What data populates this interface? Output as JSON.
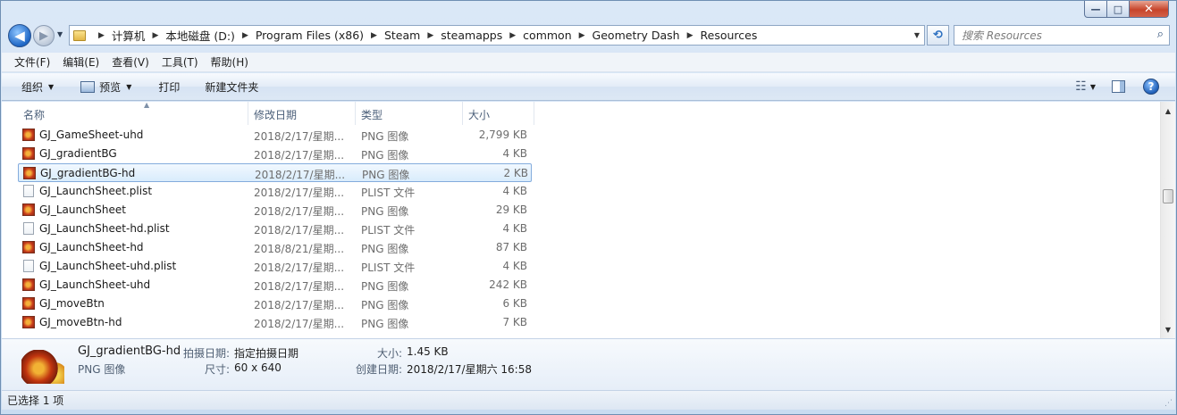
{
  "window": {
    "minimize": "—",
    "maximize": "□",
    "close": "✕"
  },
  "nav": {
    "back": "◀",
    "forward": "▶",
    "recent": "▼",
    "breadcrumb": [
      "计算机",
      "本地磁盘 (D:)",
      "Program Files (x86)",
      "Steam",
      "steamapps",
      "common",
      "Geometry Dash",
      "Resources"
    ],
    "dropdown": "▼",
    "refresh": "⟲",
    "search_placeholder": "搜索 Resources",
    "search_icon": "⌕"
  },
  "menu": [
    "文件(F)",
    "编辑(E)",
    "查看(V)",
    "工具(T)",
    "帮助(H)"
  ],
  "commands": {
    "organize": "组织",
    "preview": "预览",
    "print": "打印",
    "new_folder": "新建文件夹",
    "help": "?"
  },
  "columns": {
    "name": "名称",
    "date": "修改日期",
    "type": "类型",
    "size": "大小"
  },
  "files": [
    {
      "name": "GJ_GameSheet-uhd",
      "date": "2018/2/17/星期...",
      "type": "PNG 图像",
      "size": "2,799 KB",
      "icon": "png-icon"
    },
    {
      "name": "GJ_gradientBG",
      "date": "2018/2/17/星期...",
      "type": "PNG 图像",
      "size": "4 KB",
      "icon": "png-icon"
    },
    {
      "name": "GJ_gradientBG-hd",
      "date": "2018/2/17/星期...",
      "type": "PNG 图像",
      "size": "2 KB",
      "icon": "png-icon",
      "selected": true
    },
    {
      "name": "GJ_LaunchSheet.plist",
      "date": "2018/2/17/星期...",
      "type": "PLIST 文件",
      "size": "4 KB",
      "icon": "file-icon"
    },
    {
      "name": "GJ_LaunchSheet",
      "date": "2018/2/17/星期...",
      "type": "PNG 图像",
      "size": "29 KB",
      "icon": "png-icon"
    },
    {
      "name": "GJ_LaunchSheet-hd.plist",
      "date": "2018/2/17/星期...",
      "type": "PLIST 文件",
      "size": "4 KB",
      "icon": "file-icon"
    },
    {
      "name": "GJ_LaunchSheet-hd",
      "date": "2018/8/21/星期...",
      "type": "PNG 图像",
      "size": "87 KB",
      "icon": "png-icon"
    },
    {
      "name": "GJ_LaunchSheet-uhd.plist",
      "date": "2018/2/17/星期...",
      "type": "PLIST 文件",
      "size": "4 KB",
      "icon": "file-icon"
    },
    {
      "name": "GJ_LaunchSheet-uhd",
      "date": "2018/2/17/星期...",
      "type": "PNG 图像",
      "size": "242 KB",
      "icon": "png-icon"
    },
    {
      "name": "GJ_moveBtn",
      "date": "2018/2/17/星期...",
      "type": "PNG 图像",
      "size": "6 KB",
      "icon": "png-icon"
    },
    {
      "name": "GJ_moveBtn-hd",
      "date": "2018/2/17/星期...",
      "type": "PNG 图像",
      "size": "7 KB",
      "icon": "png-icon"
    }
  ],
  "details": {
    "filename": "GJ_gradientBG-hd",
    "filetype": "PNG 图像",
    "taken_label": "拍摄日期:",
    "taken_value": "指定拍摄日期",
    "dims_label": "尺寸:",
    "dims_value": "60 x 640",
    "size_label": "大小:",
    "size_value": "1.45 KB",
    "created_label": "创建日期:",
    "created_value": "2018/2/17/星期六 16:58"
  },
  "status": {
    "selected": "已选择 1 项"
  }
}
